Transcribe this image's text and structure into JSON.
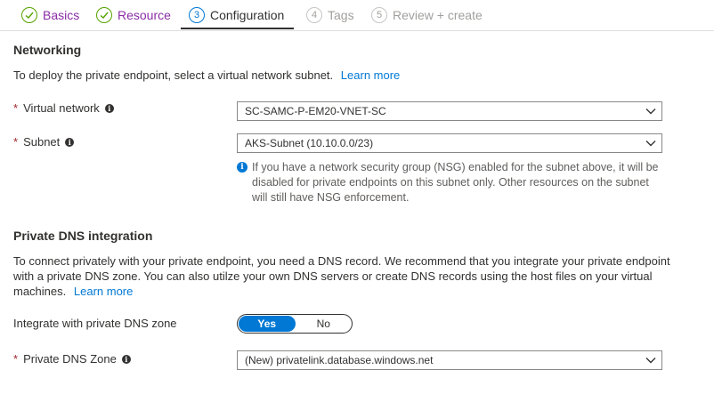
{
  "tabs": [
    {
      "number": "",
      "label": "Basics",
      "state": "done"
    },
    {
      "number": "",
      "label": "Resource",
      "state": "done"
    },
    {
      "number": "3",
      "label": "Configuration",
      "state": "active"
    },
    {
      "number": "4",
      "label": "Tags",
      "state": "disabled"
    },
    {
      "number": "5",
      "label": "Review + create",
      "state": "disabled"
    }
  ],
  "networking": {
    "heading": "Networking",
    "description": "To deploy the private endpoint, select a virtual network subnet.",
    "learn_more": "Learn more",
    "vnet_label": "Virtual network",
    "vnet_value": "SC-SAMC-P-EM20-VNET-SC",
    "subnet_label": "Subnet",
    "subnet_value": "AKS-Subnet (10.10.0.0/23)",
    "info_text": "If you have a network security group (NSG) enabled for the subnet above, it will be disabled for private endpoints on this subnet only. Other resources on the subnet will still have NSG enforcement."
  },
  "dns": {
    "heading": "Private DNS integration",
    "description": "To connect privately with your private endpoint, you need a DNS record. We recommend that you integrate your private endpoint with a private DNS zone. You can also utilze your own DNS servers or create DNS records using the host files on your virtual machines.",
    "learn_more": "Learn more",
    "integrate_label": "Integrate with private DNS zone",
    "toggle_yes": "Yes",
    "toggle_no": "No",
    "zone_label": "Private DNS Zone",
    "zone_value": "(New) privatelink.database.windows.net"
  },
  "required_marker": "*",
  "info_glyph": "i",
  "colors": {
    "accent": "#0078d4",
    "done_check": "#57a300",
    "done_label": "#8a2da5",
    "required": "#a4262c"
  },
  "icons": {
    "done": "checkmark-circle-icon",
    "chevron": "chevron-down-icon",
    "info": "info-icon"
  }
}
